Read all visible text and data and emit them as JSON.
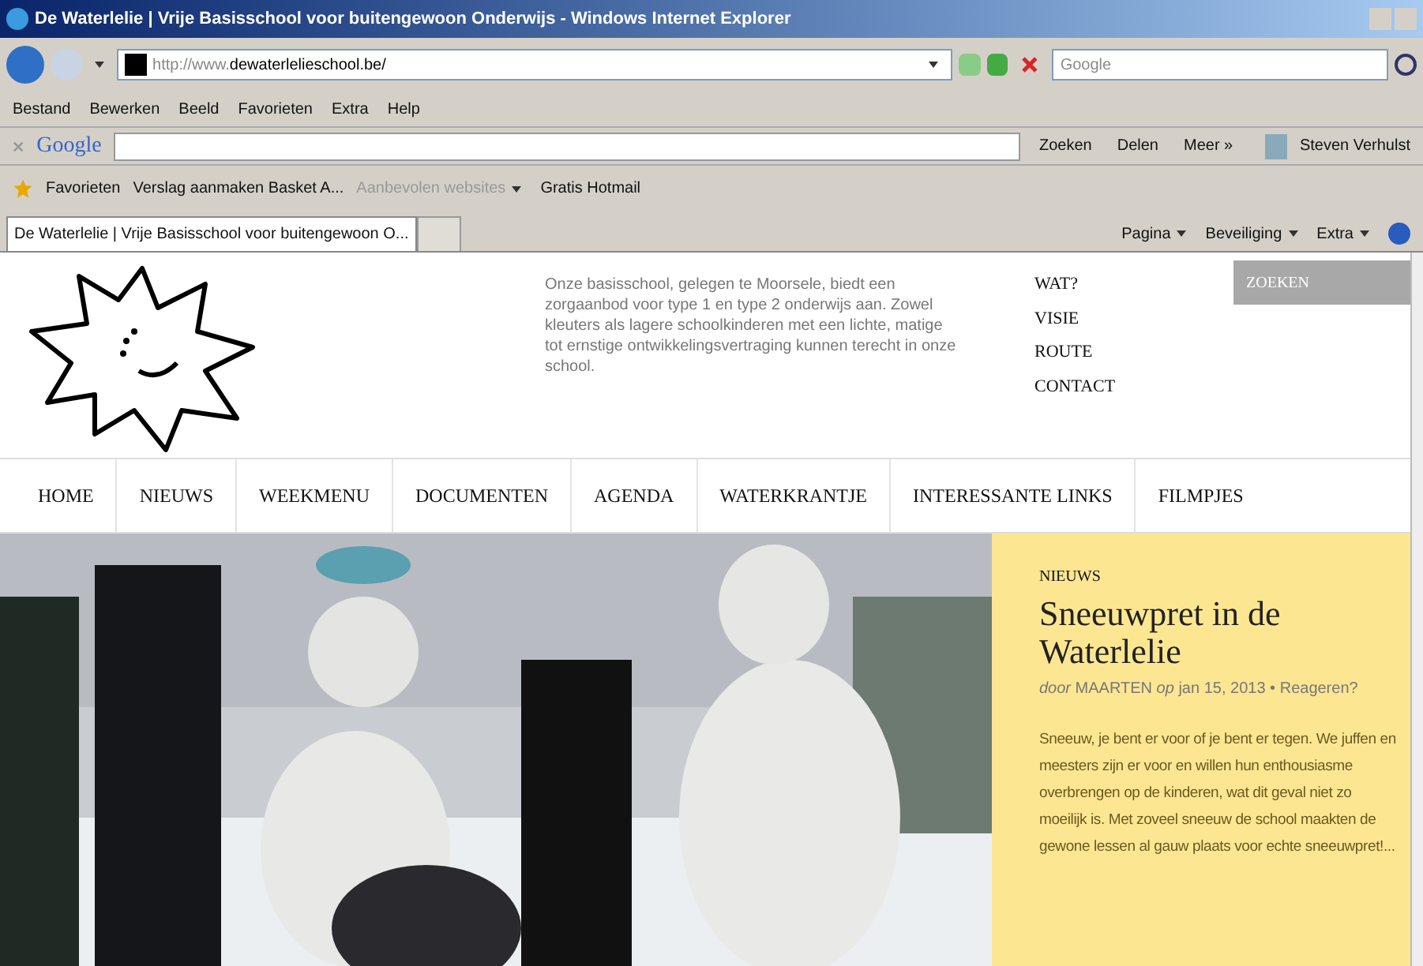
{
  "window": {
    "title": "De Waterlelie | Vrije Basisschool voor buitengewoon Onderwijs - Windows Internet Explorer"
  },
  "address_bar": {
    "url_prefix": "http://www.",
    "url_domain": "dewaterlelieschool.be/",
    "search_placeholder": "Google"
  },
  "menu": [
    "Bestand",
    "Bewerken",
    "Beeld",
    "Favorieten",
    "Extra",
    "Help"
  ],
  "google_toolbar": {
    "logo": "Google",
    "buttons": [
      "Zoeken",
      "Delen",
      "Meer »"
    ],
    "user": "Steven Verhulst"
  },
  "favorites_bar": {
    "label": "Favorieten",
    "items": [
      {
        "label": "Verslag aanmaken  Basket A...",
        "disabled": false,
        "dropdown": false
      },
      {
        "label": "Aanbevolen websites",
        "disabled": true,
        "dropdown": true
      },
      {
        "label": "Gratis Hotmail",
        "disabled": false,
        "dropdown": false
      }
    ]
  },
  "tab": {
    "label": "De Waterlelie | Vrije Basisschool voor buitengewoon O..."
  },
  "command_bar": [
    "Pagina",
    "Beveiliging",
    "Extra"
  ],
  "page": {
    "intro": "Onze basisschool, gelegen te Moorsele, biedt een zorgaanbod voor type 1 en type 2 onderwijs aan. Zowel kleuters als lagere schoolkinderen met een lichte, matige tot ernstige ontwikkelingsvertraging kunnen terecht in onze school.",
    "top_links": [
      "WAT?",
      "VISIE",
      "ROUTE",
      "CONTACT"
    ],
    "search_placeholder": "ZOEKEN",
    "nav": [
      "HOME",
      "NIEUWS",
      "WEEKMENU",
      "DOCUMENTEN",
      "AGENDA",
      "WATERKRANTJE",
      "INTERESSANTE LINKS",
      "FILMPJES"
    ],
    "feature": {
      "category": "NIEUWS",
      "title": "Sneeuwpret in de Waterlelie",
      "by": "door",
      "author": "MAARTEN",
      "on": "op",
      "date": "jan 15, 2013",
      "separator": "•",
      "comments": "Reageren?",
      "excerpt": "Sneeuw, je bent er voor of je bent er tegen. We juffen en meesters zijn er voor en willen hun enthousiasme overbrengen op de kinderen, wat dit geval niet zo moeilijk is. Met zoveel sneeuw de school maakten de gewone lessen al gauw plaats voor echte sneeuwpret!..."
    }
  }
}
